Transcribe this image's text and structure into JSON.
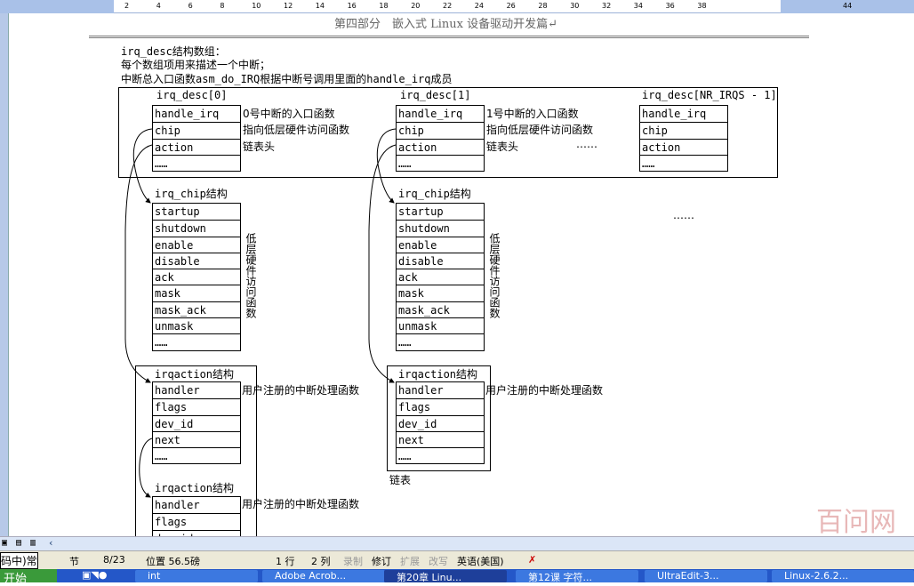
{
  "ruler": {
    "ticks": [
      "2",
      "4",
      "6",
      "8",
      "10",
      "12",
      "14",
      "16",
      "18",
      "20",
      "22",
      "24",
      "26",
      "28",
      "30",
      "32",
      "34",
      "36",
      "38",
      "44"
    ]
  },
  "header": "第四部分　嵌入式 Linux 设备驱动开发篇↵",
  "intro": [
    "irq_desc结构数组：",
    "每个数组项用来描述一个中断；",
    "中断总入口函数asm_do_IRQ根据中断号调用里面的handle_irq成员"
  ],
  "desc": [
    {
      "label": "irq_desc[0]",
      "rows": [
        "handle_irq",
        "chip",
        "action",
        "……"
      ],
      "notes": [
        "0号中断的入口函数",
        "指向低层硬件访问函数",
        "链表头"
      ]
    },
    {
      "label": "irq_desc[1]",
      "rows": [
        "handle_irq",
        "chip",
        "action",
        "……"
      ],
      "notes": [
        "1号中断的入口函数",
        "指向低层硬件访问函数",
        "链表头"
      ]
    },
    {
      "label": "irq_desc[NR_IRQS - 1]",
      "rows": [
        "handle_irq",
        "chip",
        "action",
        "……"
      ]
    }
  ],
  "ellipsis": "……",
  "chip": {
    "label": "irq_chip结构",
    "rows": [
      "startup",
      "shutdown",
      "enable",
      "disable",
      "ack",
      "mask",
      "mask_ack",
      "unmask",
      "……"
    ],
    "vnote": "低层硬件访问函数"
  },
  "action": {
    "label": "irqaction结构",
    "rows": [
      "handler",
      "flags",
      "dev_id",
      "next",
      "……"
    ],
    "note": "用户注册的中断处理函数"
  },
  "list_label": "链表",
  "watermark": "百问网",
  "status": {
    "section": "节",
    "page": "8/23",
    "position": "位置 56.5磅",
    "line": "1 行",
    "col": "2 列",
    "rec": "录制",
    "trk": "修订",
    "ext": "扩展",
    "ovr": "改写",
    "lang": "英语(美国)"
  },
  "taskbar": {
    "start": "开始",
    "items": [
      "int",
      "Adobe Acrob...",
      "第20章 Linu...",
      "第12课 字符...",
      "UltraEdit-3...",
      "Linux-2.6.2..."
    ]
  }
}
